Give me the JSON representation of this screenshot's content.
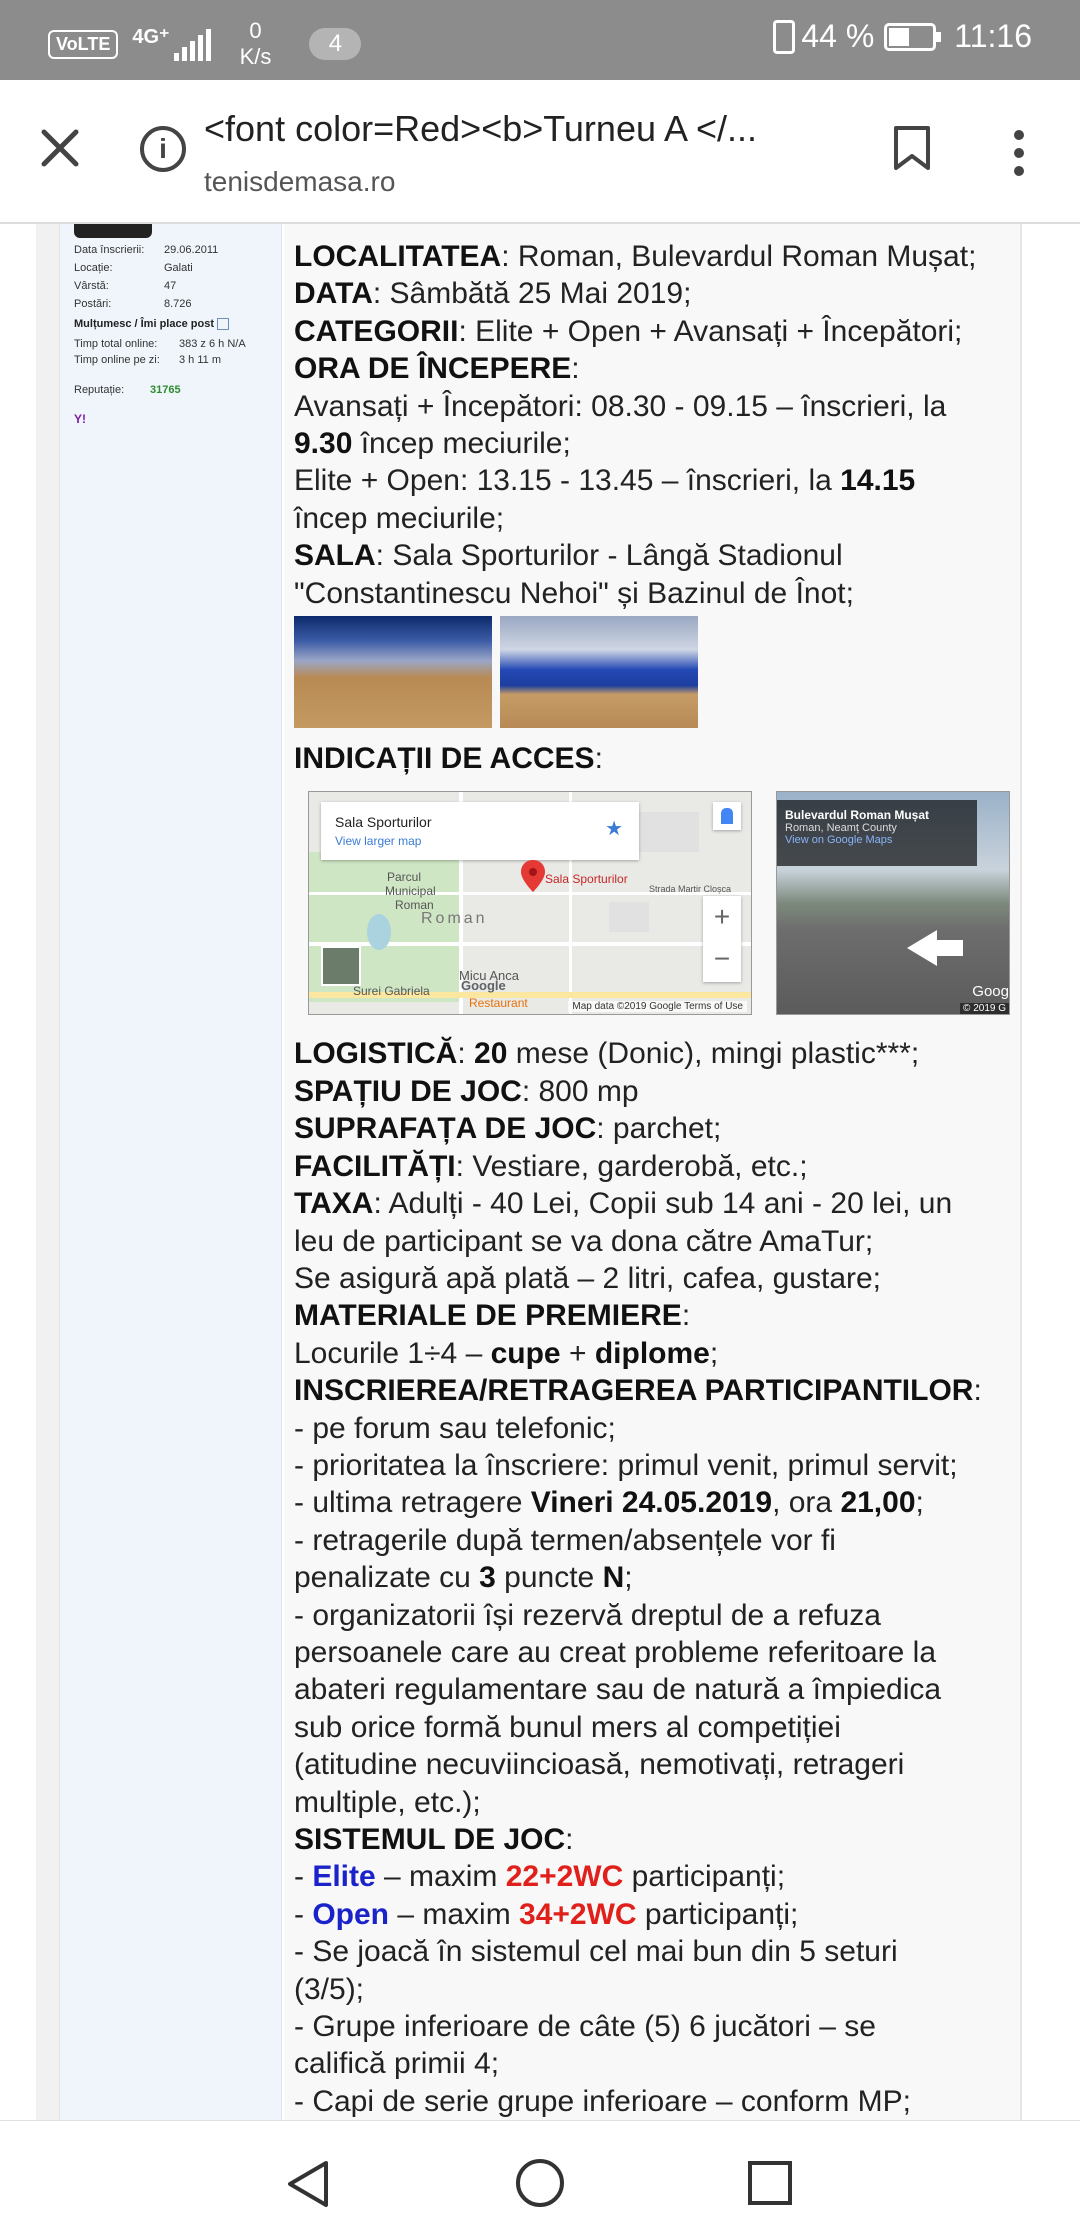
{
  "status_bar": {
    "volte": "VoLTE",
    "network": "4G⁺",
    "speed_value": "0",
    "speed_unit": "K/s",
    "notification_count": "4",
    "battery": "44 %",
    "time": "11:16"
  },
  "browser": {
    "title": "<font color=Red><b>Turneu A </...",
    "url": "tenisdemasa.ro"
  },
  "profile": {
    "rows": [
      {
        "label": "Data înscrierii:",
        "value": "29.06.2011"
      },
      {
        "label": "Locație:",
        "value": "Galati"
      },
      {
        "label": "Vârstă:",
        "value": "47"
      },
      {
        "label": "Postări:",
        "value": "8.726"
      }
    ],
    "thanks": "Mulțumesc / Îmi place post",
    "time_total_label": "Timp total online:",
    "time_total_value": "383 z 6 h N/A",
    "time_day_label": "Timp online pe zi:",
    "time_day_value": "3 h 11 m",
    "reputation_label": "Reputație:",
    "reputation_value": "31765",
    "yahoo": "Y!"
  },
  "post": {
    "l1_label": "LOCALITATEA",
    "l1_text": ": Roman, Bulevardul Roman Mușat;",
    "l2_label": "DATA",
    "l2_text": ": Sâmbătă 25 Mai 2019;",
    "l3_label": "CATEGORII",
    "l3_text": ": Elite + Open + Avansați + Începători;",
    "l4_label": "ORA DE ÎNCEPERE",
    "l4_text": ":",
    "l5_text": "Avansați + Începători: 08.30 - 09.15 – înscrieri, la",
    "l6_bold": "9.30",
    "l6_text": " încep meciurile;",
    "l7_text": "Elite + Open: 13.15 - 13.45 – înscrieri, la ",
    "l7_bold": "14.15",
    "l8_text": "încep meciurile;",
    "l9_label": "SALA",
    "l9_text": ": Sala Sporturilor - Lângă Stadionul",
    "l10_text": "\"Constantinescu Nehoi\" și Bazinul de Înot;",
    "l11_label": "INDICAȚII DE ACCES",
    "l11_text": ":",
    "l12_label": "LOGISTICĂ",
    "l12_text_a": ": ",
    "l12_bold": "20",
    "l12_text_b": " mese (Donic), mingi plastic***;",
    "l13_label": "SPAȚIU DE JOC",
    "l13_text": ": 800 mp",
    "l14_label": "SUPRAFAȚA DE JOC",
    "l14_text": ": parchet;",
    "l15_label": "FACILITĂȚI",
    "l15_text": ": Vestiare, garderobă, etc.;",
    "l16_label": "TAXA",
    "l16_text": ": Adulți - 40 Lei, Copii sub 14 ani - 20 lei, un",
    "l17_text": "leu de participant se va dona către AmaTur;",
    "l18_text": "Se asigură apă plată – 2 litri, cafea, gustare;",
    "l19_label": "MATERIALE DE PREMIERE",
    "l19_text": ":",
    "l20_text_a": "Locurile 1÷4 – ",
    "l20_bold_a": "cupe",
    "l20_text_b": " + ",
    "l20_bold_b": "diplome",
    "l20_text_c": ";",
    "l21_label": "INSCRIEREA/RETRAGEREA PARTICIPANTILOR",
    "l21_text": ":",
    "l22_text": "- pe forum sau telefonic;",
    "l23_text": "- prioritatea la înscriere: primul venit, primul servit;",
    "l24_text_a": "- ultima retragere ",
    "l24_bold_a": "Vineri 24.05.2019",
    "l24_text_b": ", ora ",
    "l24_bold_b": "21,00",
    "l24_text_c": ";",
    "l25_text": "- retragerile după termen/absențele vor fi",
    "l26_text_a": "penalizate cu ",
    "l26_bold_a": "3",
    "l26_text_b": " puncte ",
    "l26_bold_b": "N",
    "l26_text_c": ";",
    "l27_text": "- organizatorii își rezervă dreptul de a refuza",
    "l28_text": "persoanele care au creat probleme referitoare la",
    "l29_text": "abateri regulamentare sau de natură a împiedica",
    "l30_text": "sub orice formă bunul mers al competiției",
    "l31_text": "(atitudine necuviincioasă, nemotivați, retrageri",
    "l32_text": "multiple, etc.);",
    "l33_label": "SISTEMUL DE JOC",
    "l33_text": ":",
    "l34_dash": "- ",
    "l34_cat": "Elite",
    "l34_mid": " – maxim ",
    "l34_num": "22+2WC",
    "l34_end": " participanți;",
    "l35_dash": "- ",
    "l35_cat": "Open",
    "l35_mid": " – maxim ",
    "l35_num": "34+2WC",
    "l35_end": " participanți;",
    "l36_text": "- Se joacă în sistemul cel mai bun din 5 seturi",
    "l37_text": "(3/5);",
    "l38_text": "- Grupe inferioare de câte (5) 6 jucători – se",
    "l39_text": "califică primii 4;",
    "l40_text": "- Capi de serie grupe inferioare – conform MP;"
  },
  "map": {
    "card_title": "Sala Sporturilor",
    "card_link": "View larger map",
    "label_park_1": "Parcul",
    "label_park_2": "Municipal",
    "label_park_3": "Roman",
    "label_city": "Roman",
    "label_pin": "Sala Sporturilor",
    "label_street": "Strada Martir Cloșca",
    "label_micu": "Micu Anca",
    "label_surei": "Surei Gabriela",
    "label_restaurant": "Restaurant",
    "label_google": "Google",
    "footer": "Map data ©2019 Google   Terms of Use"
  },
  "streetview": {
    "title": "Bulevardul Roman Mușat",
    "subtitle": "Roman, Neamț County",
    "link": "View on Google Maps",
    "google": "Goog",
    "copyright": "© 2019 G"
  }
}
